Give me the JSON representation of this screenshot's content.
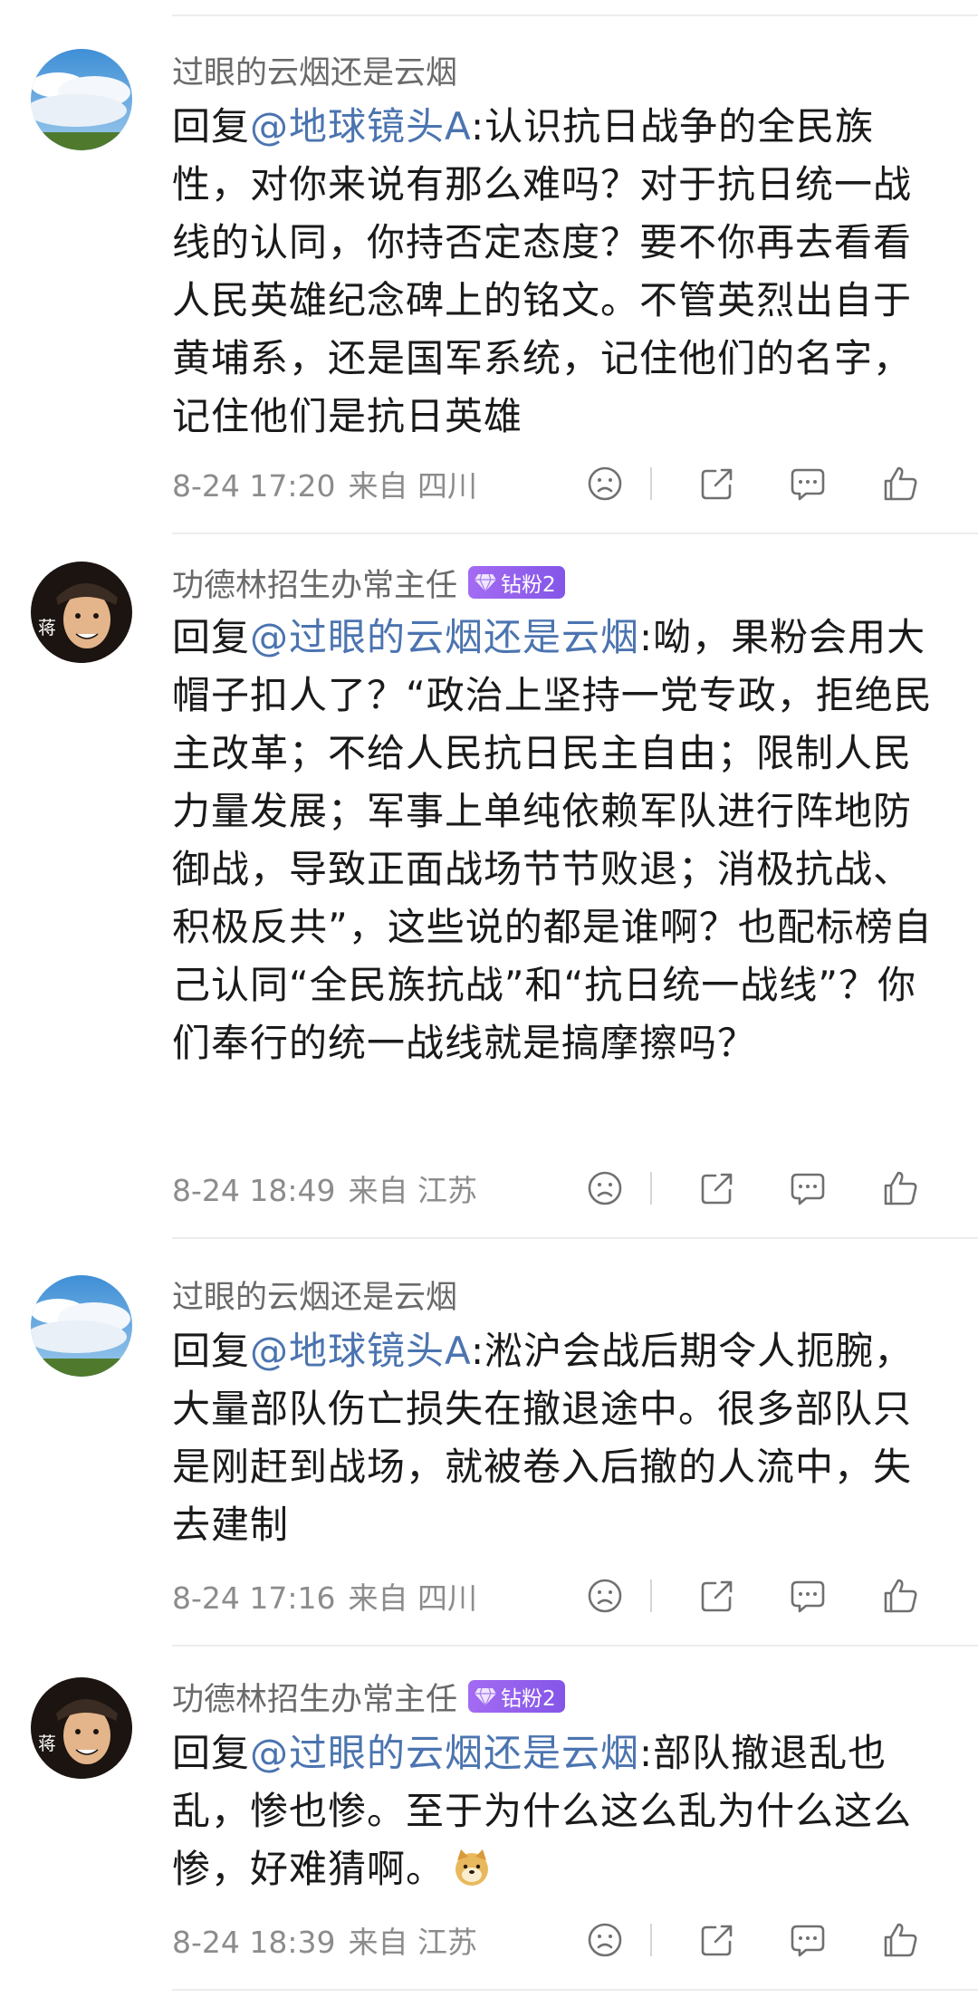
{
  "comments": [
    {
      "username": "过眼的云烟还是云烟",
      "badge": "",
      "reply_prefix": "回复",
      "mention": "@地球镜头A",
      "content": ":认识抗日战争的全民族性，对你来说有那么难吗？对于抗日统一战线的认同，你持否定态度？要不你再去看看人民英雄纪念碑上的铭文。不管英烈出自于黄埔系，还是国军系统，记住他们的名字，记住他们是抗日英雄",
      "time": "8-24 17:20",
      "location": "来自 四川"
    },
    {
      "username": "功德林招生办常主任",
      "badge": "钻粉2",
      "reply_prefix": "回复",
      "mention": "@过眼的云烟还是云烟",
      "content": ":呦，果粉会用大帽子扣人了？“政治上坚持一党专政，拒绝民主改革；不给人民抗日民主自由；限制人民力量发展；军事上单纯依赖军队进行阵地防御战，导致正面战场节节败退；消极抗战、积极反共”，这些说的都是谁啊？也配标榜自己认同“全民族抗战”和“抗日统一战线”？你们奉行的统一战线就是搞摩擦吗？",
      "time": "8-24 18:49",
      "location": "来自 江苏"
    },
    {
      "username": "过眼的云烟还是云烟",
      "badge": "",
      "reply_prefix": "回复",
      "mention": "@地球镜头A",
      "content": ":淞沪会战后期令人扼腕，大量部队伤亡损失在撤退途中。很多部队只是刚赶到战场，就被卷入后撤的人流中，失去建制",
      "time": "8-24 17:16",
      "location": "来自 四川"
    },
    {
      "username": "功德林招生办常主任",
      "badge": "钻粉2",
      "reply_prefix": "回复",
      "mention": "@过眼的云烟还是云烟",
      "content": ":部队撤退乱也乱，惨也惨。至于为什么这么乱为什么这么惨，好难猜啊。",
      "emoji": "doge-emoji",
      "time": "8-24 18:39",
      "location": "来自 江苏"
    }
  ],
  "colors": {
    "mention": "#4b74b0",
    "username": "#6a6a6a",
    "meta": "#8c8c8c",
    "badge": "#8456e8"
  },
  "icons": [
    "dislike-icon",
    "share-icon",
    "comment-icon",
    "like-icon"
  ]
}
